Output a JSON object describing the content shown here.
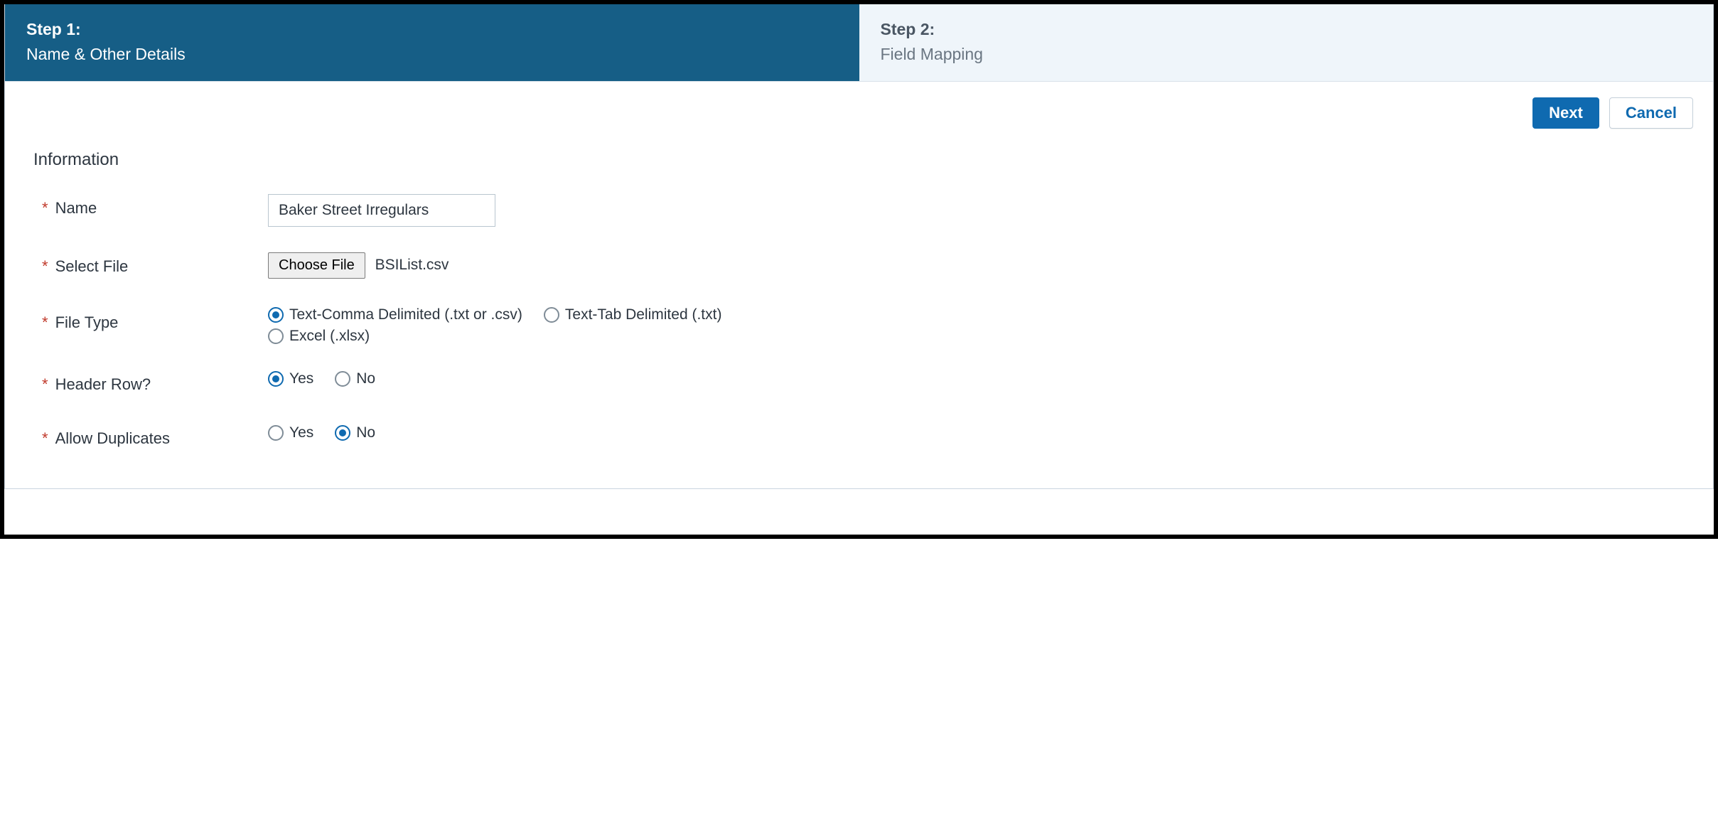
{
  "steps": {
    "step1_num": "Step 1:",
    "step1_title": "Name & Other Details",
    "step2_num": "Step 2:",
    "step2_title": "Field Mapping"
  },
  "actions": {
    "next": "Next",
    "cancel": "Cancel"
  },
  "section": {
    "title": "Information"
  },
  "form": {
    "required_marker": "*",
    "name": {
      "label": "Name",
      "value": "Baker Street Irregulars"
    },
    "select_file": {
      "label": "Select File",
      "button": "Choose File",
      "filename": "BSIList.csv"
    },
    "file_type": {
      "label": "File Type",
      "options": {
        "csv": "Text-Comma Delimited (.txt or .csv)",
        "tab": "Text-Tab Delimited (.txt)",
        "xlsx": "Excel (.xlsx)"
      },
      "selected": "csv"
    },
    "header_row": {
      "label": "Header Row?",
      "options": {
        "yes": "Yes",
        "no": "No"
      },
      "selected": "yes"
    },
    "allow_duplicates": {
      "label": "Allow Duplicates",
      "options": {
        "yes": "Yes",
        "no": "No"
      },
      "selected": "no"
    }
  }
}
